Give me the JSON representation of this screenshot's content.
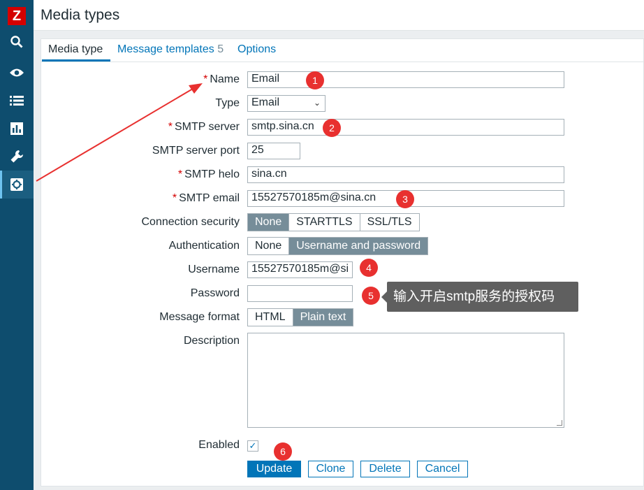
{
  "sidebar": {
    "logo": "Z",
    "icons": [
      "search-icon",
      "eye-icon",
      "list-icon",
      "bar-chart-icon",
      "wrench-icon",
      "gear-icon"
    ]
  },
  "header": {
    "title": "Media types"
  },
  "tabs": [
    {
      "label": "Media type"
    },
    {
      "label": "Message templates",
      "count": "5"
    },
    {
      "label": "Options"
    }
  ],
  "form": {
    "name_label": "Name",
    "name_value": "Email",
    "type_label": "Type",
    "type_value": "Email",
    "smtp_server_label": "SMTP server",
    "smtp_server_value": "smtp.sina.cn",
    "smtp_port_label": "SMTP server port",
    "smtp_port_value": "25",
    "smtp_helo_label": "SMTP helo",
    "smtp_helo_value": "sina.cn",
    "smtp_email_label": "SMTP email",
    "smtp_email_value": "15527570185m@sina.cn",
    "conn_security_label": "Connection security",
    "conn_security_options": [
      "None",
      "STARTTLS",
      "SSL/TLS"
    ],
    "auth_label": "Authentication",
    "auth_options": [
      "None",
      "Username and password"
    ],
    "username_label": "Username",
    "username_value": "15527570185m@si",
    "password_label": "Password",
    "password_value": "",
    "message_format_label": "Message format",
    "message_format_options": [
      "HTML",
      "Plain text"
    ],
    "description_label": "Description",
    "enabled_label": "Enabled",
    "enabled_mark": "✓"
  },
  "buttons": {
    "update": "Update",
    "clone": "Clone",
    "delete": "Delete",
    "cancel": "Cancel"
  },
  "annotations": {
    "badges": [
      "1",
      "2",
      "3",
      "4",
      "5",
      "6"
    ],
    "tooltip": "输入开启smtp服务的授权码"
  },
  "colors": {
    "sidebar": "#0e4d6e",
    "accent": "#0275b8",
    "segment_on": "#768d99",
    "badge": "#e8302f"
  }
}
